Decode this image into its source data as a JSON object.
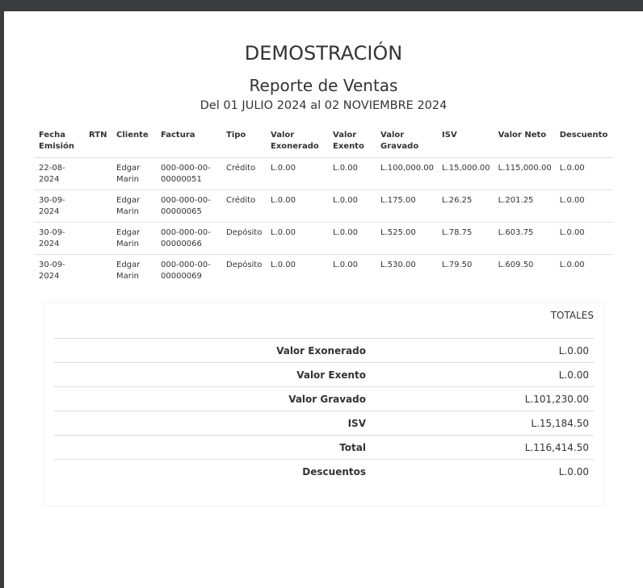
{
  "company": "DEMOSTRACIÓN",
  "report_title": "Reporte de Ventas",
  "date_range": "Del 01 JULIO 2024 al 02 NOVIEMBRE 2024",
  "table": {
    "headers": {
      "fecha_1": "Fecha",
      "fecha_2": "Emisión",
      "rtn": "RTN",
      "cliente": "Cliente",
      "factura": "Factura",
      "tipo": "Tipo",
      "exonerado_1": "Valor",
      "exonerado_2": "Exonerado",
      "exento_1": "Valor",
      "exento_2": "Exento",
      "gravado_1": "Valor",
      "gravado_2": "Gravado",
      "isv": "ISV",
      "neto": "Valor Neto",
      "descuento": "Descuento"
    },
    "rows": [
      {
        "fecha_a": "22-08-",
        "fecha_b": "2024",
        "rtn": "",
        "cliente_a": "Edgar",
        "cliente_b": "Marin",
        "factura_a": "000-000-00-",
        "factura_b": "00000051",
        "tipo": "Crédito",
        "exonerado": "L.0.00",
        "exento": "L.0.00",
        "gravado": "L.100,000.00",
        "isv": "L.15,000.00",
        "neto": "L.115,000.00",
        "descuento": "L.0.00"
      },
      {
        "fecha_a": "30-09-",
        "fecha_b": "2024",
        "rtn": "",
        "cliente_a": "Edgar",
        "cliente_b": "Marin",
        "factura_a": "000-000-00-",
        "factura_b": "00000065",
        "tipo": "Crédito",
        "exonerado": "L.0.00",
        "exento": "L.0.00",
        "gravado": "L.175.00",
        "isv": "L.26.25",
        "neto": "L.201.25",
        "descuento": "L.0.00"
      },
      {
        "fecha_a": "30-09-",
        "fecha_b": "2024",
        "rtn": "",
        "cliente_a": "Edgar",
        "cliente_b": "Marin",
        "factura_a": "000-000-00-",
        "factura_b": "00000066",
        "tipo": "Depósito",
        "exonerado": "L.0.00",
        "exento": "L.0.00",
        "gravado": "L.525.00",
        "isv": "L.78.75",
        "neto": "L.603.75",
        "descuento": "L.0.00"
      },
      {
        "fecha_a": "30-09-",
        "fecha_b": "2024",
        "rtn": "",
        "cliente_a": "Edgar",
        "cliente_b": "Marin",
        "factura_a": "000-000-00-",
        "factura_b": "00000069",
        "tipo": "Depósito",
        "exonerado": "L.0.00",
        "exento": "L.0.00",
        "gravado": "L.530.00",
        "isv": "L.79.50",
        "neto": "L.609.50",
        "descuento": "L.0.00"
      }
    ]
  },
  "totals": {
    "heading": "TOTALES",
    "items": [
      {
        "label": "Valor Exonerado",
        "value": "L.0.00"
      },
      {
        "label": "Valor Exento",
        "value": "L.0.00"
      },
      {
        "label": "Valor Gravado",
        "value": "L.101,230.00"
      },
      {
        "label": "ISV",
        "value": "L.15,184.50"
      },
      {
        "label": "Total",
        "value": "L.116,414.50"
      },
      {
        "label": "Descuentos",
        "value": "L.0.00"
      }
    ]
  }
}
